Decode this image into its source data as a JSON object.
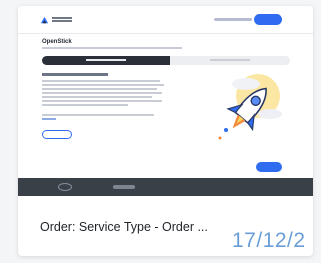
{
  "card": {
    "caption": "Order: Service Type - Order ...",
    "date": "17/12/2"
  },
  "preview": {
    "page_title": "OpenStick",
    "colors": {
      "accent": "#2f6cf0",
      "footer": "#3a4048",
      "date": "#6a9ed8"
    },
    "illustration": "rocket-icon"
  }
}
